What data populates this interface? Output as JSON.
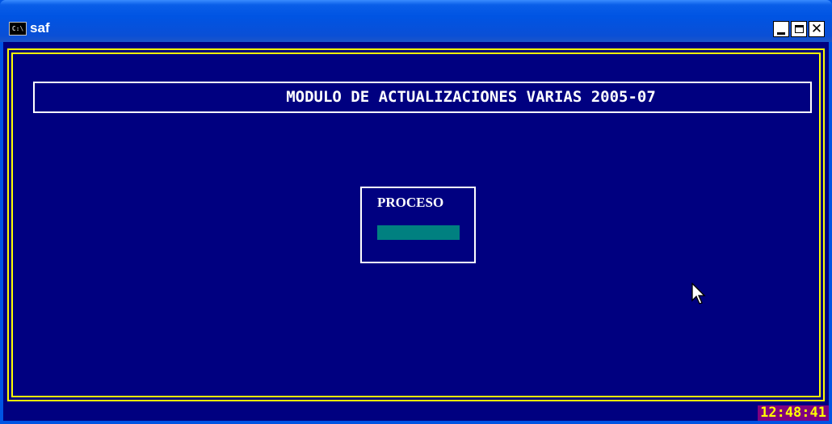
{
  "window": {
    "title": "saf",
    "icon": "console-icon",
    "icon_text": "C:\\",
    "buttons": [
      "minimize",
      "maximize",
      "close"
    ]
  },
  "console": {
    "header": "MODULO DE ACTUALIZACIONES VARIAS 2005-07",
    "process_label": "PROCESO",
    "progress": 1.0,
    "clock": "12:48:41"
  },
  "colors": {
    "background": "#000080",
    "frame": "#ffff00",
    "text": "#ffffff",
    "progress": "#008080",
    "clock_bg": "#800080",
    "clock_fg": "#ffff00"
  }
}
